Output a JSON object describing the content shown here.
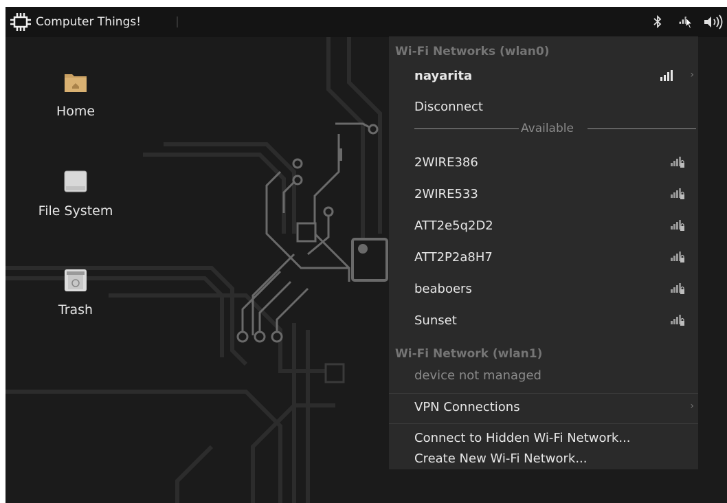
{
  "panel": {
    "menu_label": "Computer Things!",
    "icons": [
      "bluetooth-icon",
      "network-signal-icon",
      "volume-icon"
    ]
  },
  "desktop": {
    "icons": [
      {
        "label": "Home",
        "icon": "home-folder-icon"
      },
      {
        "label": "File System",
        "icon": "drive-icon"
      },
      {
        "label": "Trash",
        "icon": "trash-icon"
      }
    ]
  },
  "network_menu": {
    "wlan0_header": "Wi-Fi Networks (wlan0)",
    "connected": {
      "name": "nayarita"
    },
    "disconnect_label": "Disconnect",
    "available_label": "Available",
    "available": [
      {
        "name": "2WIRE386"
      },
      {
        "name": "2WIRE533"
      },
      {
        "name": "ATT2e5q2D2"
      },
      {
        "name": "ATT2P2a8H7"
      },
      {
        "name": "beaboers"
      },
      {
        "name": "Sunset"
      }
    ],
    "wlan1_header": "Wi-Fi Network (wlan1)",
    "wlan1_status": "device not managed",
    "vpn_label": "VPN Connections",
    "hidden_label": "Connect to Hidden Wi-Fi Network...",
    "create_label": "Create New Wi-Fi Network..."
  },
  "colors": {
    "desktop_bg": "#1b1b1b",
    "panel_bg": "#141414",
    "menu_bg": "#2a2a2a",
    "header_text": "#757575"
  }
}
